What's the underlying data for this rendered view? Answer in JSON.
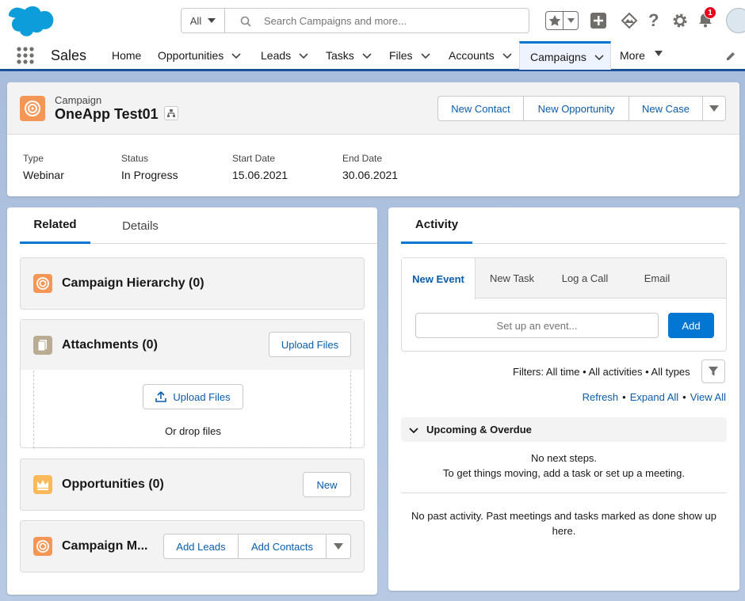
{
  "header": {
    "search_scope": "All",
    "search_placeholder": "Search Campaigns and more...",
    "notification_count": "1"
  },
  "nav": {
    "app_name": "Sales",
    "items": [
      {
        "label": "Home"
      },
      {
        "label": "Opportunities"
      },
      {
        "label": "Leads"
      },
      {
        "label": "Tasks"
      },
      {
        "label": "Files"
      },
      {
        "label": "Accounts"
      },
      {
        "label": "Campaigns"
      },
      {
        "label": "More"
      }
    ]
  },
  "record": {
    "object_label": "Campaign",
    "name": "OneApp Test01",
    "actions": [
      "New Contact",
      "New Opportunity",
      "New Case"
    ],
    "fields": [
      {
        "label": "Type",
        "value": "Webinar"
      },
      {
        "label": "Status",
        "value": "In Progress"
      },
      {
        "label": "Start Date",
        "value": "15.06.2021"
      },
      {
        "label": "End Date",
        "value": "30.06.2021"
      }
    ]
  },
  "related": {
    "tabs": [
      "Related",
      "Details"
    ],
    "hierarchy_title": "Campaign Hierarchy (0)",
    "attachments_title": "Attachments (0)",
    "upload_files_btn": "Upload Files",
    "upload_files_inner": "Upload Files",
    "drop_text": "Or drop files",
    "opportunities_title": "Opportunities (0)",
    "new_btn": "New",
    "members_title": "Campaign M...",
    "add_leads_btn": "Add Leads",
    "add_contacts_btn": "Add Contacts"
  },
  "activity": {
    "tab": "Activity",
    "subtabs": [
      "New Event",
      "New Task",
      "Log a Call",
      "Email"
    ],
    "event_placeholder": "Set up an event...",
    "add_btn": "Add",
    "filters": "Filters: All time • All activities • All types",
    "refresh": "Refresh",
    "expand_all": "Expand All",
    "view_all": "View All",
    "upcoming_title": "Upcoming & Overdue",
    "no_next_steps": "No next steps.",
    "next_steps_hint": "To get things moving, add a task or set up a meeting.",
    "no_past": "No past activity. Past meetings and tasks marked as done show up here."
  },
  "colors": {
    "brand_blue": "#0176d3",
    "link_blue": "#0b5cab",
    "campaign_orange": "#f49756",
    "attachment_tan": "#baac93",
    "opportunity_gold": "#fcb95b",
    "nav_active": "#1b5297"
  }
}
